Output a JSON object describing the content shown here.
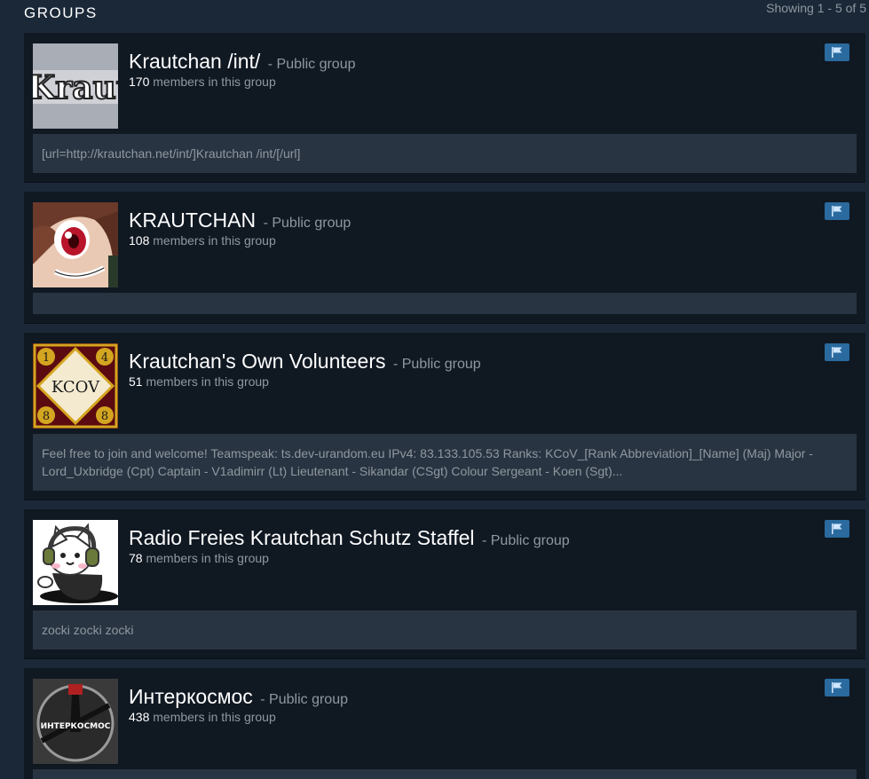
{
  "header": {
    "title": "GROUPS",
    "showing": "Showing 1 - 5 of 5"
  },
  "groups": [
    {
      "name": "Krautchan /int/",
      "type": "- Public group",
      "member_count": "170",
      "member_label": "members in this group",
      "summary": "[url=http://krautchan.net/int/]Krautchan /int/[/url]",
      "avatar_icon": "krautchan-fraktur-logo",
      "avatar_text": "Kraut"
    },
    {
      "name": "KRAUTCHAN",
      "type": "- Public group",
      "member_count": "108",
      "member_label": "members in this group",
      "summary": "",
      "avatar_icon": "anime-face-avatar"
    },
    {
      "name": "Krautchan's Own Volunteers",
      "type": "- Public group",
      "member_count": "51",
      "member_label": "members in this group",
      "summary": "Feel free to join and welcome! Teamspeak: ts.dev-urandom.eu IPv4: 83.133.105.53 Ranks: KCoV_[Rank Abbreviation]_[Name] (Maj) Major - Lord_Uxbridge (Cpt) Captain - V1adimirr (Lt) Lieutenant - Sikandar (CSgt) Colour Sergeant - Koen (Sgt)...",
      "avatar_icon": "kcov-emblem",
      "avatar_text": "KCOV",
      "avatar_corners": [
        "1",
        "4",
        "8",
        "8"
      ]
    },
    {
      "name": "Radio Freies Krautchan Schutz Staffel",
      "type": "- Public group",
      "member_count": "78",
      "member_label": "members in this group",
      "summary": "zocki zocki zocki",
      "avatar_icon": "cat-headphones-avatar"
    },
    {
      "name": "Интеркосмос",
      "type": "- Public group",
      "member_count": "438",
      "member_label": "members in this group",
      "summary": "",
      "avatar_icon": "interkosmos-logo",
      "avatar_text": "ИНТЕРКОСМОС"
    }
  ],
  "colors": {
    "background": "#1b2838",
    "card": "#101822",
    "summary": "#293442",
    "flag_button": "#2a6a9e",
    "muted_text": "#8f98a0"
  },
  "icons": {
    "report": "flag-icon"
  }
}
